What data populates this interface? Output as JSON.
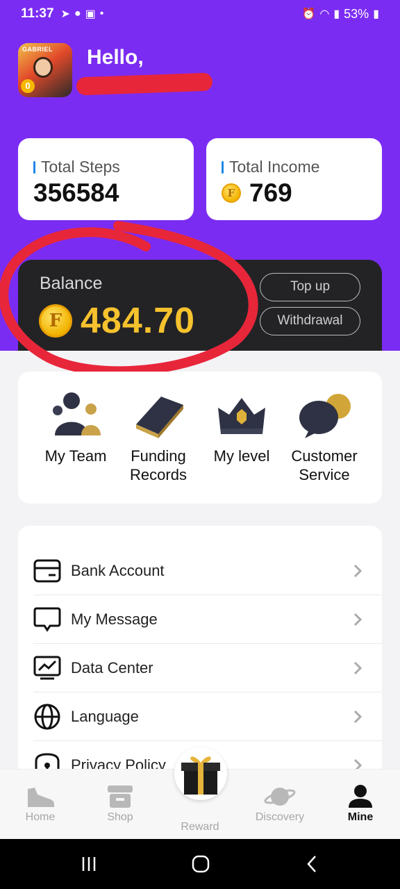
{
  "status_bar": {
    "time": "11:37",
    "battery": "53%"
  },
  "header": {
    "greeting": "Hello,",
    "avatar_caption": "GABRIEL",
    "avatar_level": "0"
  },
  "stats": {
    "steps_label": "Total Steps",
    "steps_value": "356584",
    "income_label": "Total Income",
    "income_value": "769"
  },
  "balance": {
    "label": "Balance",
    "value": "484.70",
    "coin_letter": "F",
    "top_up_label": "Top up",
    "withdrawal_label": "Withdrawal"
  },
  "actions": [
    {
      "label_line1": "My Team",
      "label_line2": ""
    },
    {
      "label_line1": "Funding",
      "label_line2": "Records"
    },
    {
      "label_line1": "My level",
      "label_line2": ""
    },
    {
      "label_line1": "Customer",
      "label_line2": "Service"
    }
  ],
  "menu": [
    {
      "label": "Bank Account",
      "icon": "bank-card-icon"
    },
    {
      "label": "My Message",
      "icon": "message-icon"
    },
    {
      "label": "Data Center",
      "icon": "data-chart-icon"
    },
    {
      "label": "Language",
      "icon": "globe-icon"
    },
    {
      "label": "Privacy Policy",
      "icon": "lock-icon"
    }
  ],
  "bottom_nav": [
    {
      "label": "Home",
      "icon": "shoe-icon",
      "active": false
    },
    {
      "label": "Shop",
      "icon": "store-icon",
      "active": false
    },
    {
      "label": "Reward",
      "icon": "gift-icon",
      "active": false
    },
    {
      "label": "Discovery",
      "icon": "planet-icon",
      "active": false
    },
    {
      "label": "Mine",
      "icon": "user-icon",
      "active": true
    }
  ],
  "colors": {
    "header_purple": "#7b2cf2",
    "balance_gold": "#f6c22d",
    "annotation_red": "#e8263a"
  }
}
